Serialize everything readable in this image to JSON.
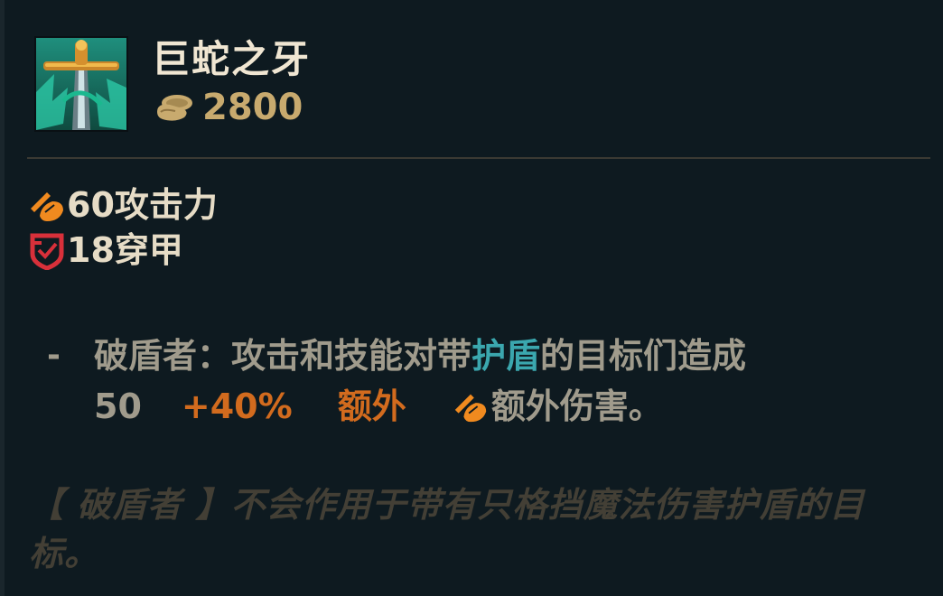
{
  "item": {
    "name": "巨蛇之牙",
    "price": "2800",
    "icon": "sword-item-icon",
    "gold_icon": "gold-coins-icon"
  },
  "stats": [
    {
      "icon": "attack-damage-icon",
      "text": "60攻击力"
    },
    {
      "icon": "armor-penetration-icon",
      "text": "18穿甲"
    }
  ],
  "passive": {
    "dash": "-",
    "line1": {
      "name": "破盾者：攻击和技能对带",
      "keyword": "护盾",
      "rest": "的目标们造成"
    },
    "line2": {
      "base": "50",
      "ratio": "+40%",
      "bonus": "额外",
      "suffix": "额外伤害。"
    }
  },
  "note": "【 破盾者 】不会作用于带有只格挡魔法伤害护盾的目标。",
  "colors": {
    "background": "#0e1a20",
    "title": "#f0e6d2",
    "gold": "#c8aa6e",
    "body": "#a09b8c",
    "keyword_blue": "#3ba7ae",
    "scaling_orange": "#d26b1e",
    "note": "#433f35"
  }
}
